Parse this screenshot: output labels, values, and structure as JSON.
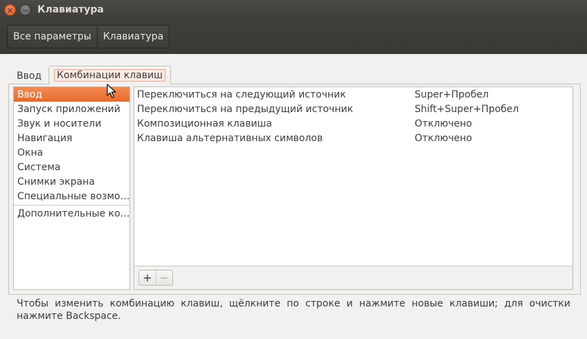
{
  "window": {
    "title": "Клавиатура",
    "controls": {
      "close": "×",
      "minimize": "−"
    }
  },
  "toolbar": {
    "breadcrumbs": [
      "Все параметры",
      "Клавиатура"
    ]
  },
  "tabs": [
    {
      "label": "Ввод",
      "active": false
    },
    {
      "label": "Комбинации клавиш",
      "active": true
    }
  ],
  "categories": [
    {
      "label": "Ввод",
      "selected": true
    },
    {
      "label": "Запуск приложений",
      "selected": false
    },
    {
      "label": "Звук и носители",
      "selected": false
    },
    {
      "label": "Навигация",
      "selected": false
    },
    {
      "label": "Окна",
      "selected": false
    },
    {
      "label": "Система",
      "selected": false
    },
    {
      "label": "Снимки экрана",
      "selected": false
    },
    {
      "label": "Специальные возмо…",
      "selected": false
    },
    {
      "label": "Дополнительные ко…",
      "selected": false
    }
  ],
  "shortcuts": [
    {
      "name": "Переключиться на следующий источник",
      "key": "Super+Пробел"
    },
    {
      "name": "Переключиться на предыдущий источник",
      "key": "Shift+Super+Пробел"
    },
    {
      "name": "Композиционная клавиша",
      "key": "Отключено"
    },
    {
      "name": "Клавиша альтернативных символов",
      "key": "Отключено"
    }
  ],
  "list_buttons": {
    "add": "+",
    "remove": "−"
  },
  "hint": "Чтобы изменить комбинацию клавиш, щёлкните по строке и нажмите новые клавиши; для очистки нажмите Backspace.",
  "colors": {
    "accent": "#e56a2c",
    "titlebar": "#3d3c38",
    "background": "#f2f1f0"
  }
}
